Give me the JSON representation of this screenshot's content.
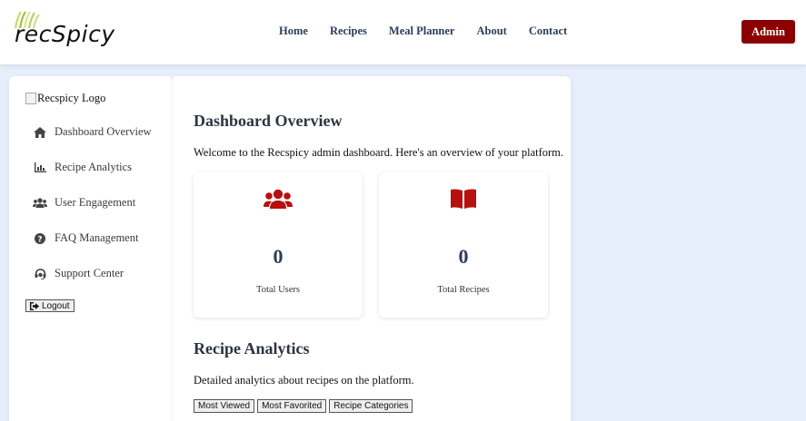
{
  "brand": {
    "logo_text": "recSpicy",
    "accent": "#8b0000"
  },
  "nav": {
    "items": [
      "Home",
      "Recipes",
      "Meal Planner",
      "About",
      "Contact"
    ]
  },
  "header": {
    "admin_label": "Admin"
  },
  "sidebar": {
    "logo_alt": "Recspicy Logo",
    "items": [
      {
        "label": "Dashboard Overview",
        "icon": "home-icon"
      },
      {
        "label": "Recipe Analytics",
        "icon": "bar-chart-icon"
      },
      {
        "label": "User Engagement",
        "icon": "users-icon"
      },
      {
        "label": "FAQ Management",
        "icon": "question-circle-icon"
      },
      {
        "label": "Support Center",
        "icon": "headset-icon"
      }
    ],
    "logout_label": "Logout"
  },
  "main": {
    "overview_title": "Dashboard Overview",
    "overview_text": "Welcome to the Recspicy admin dashboard. Here's an overview of your platform.",
    "cards": [
      {
        "value": "0",
        "label": "Total Users",
        "icon": "users-icon"
      },
      {
        "value": "0",
        "label": "Total Recipes",
        "icon": "book-icon"
      }
    ],
    "analytics_title": "Recipe Analytics",
    "analytics_text": "Detailed analytics about recipes on the platform.",
    "tabs": [
      "Most Viewed",
      "Most Favorited",
      "Recipe Categories"
    ]
  }
}
